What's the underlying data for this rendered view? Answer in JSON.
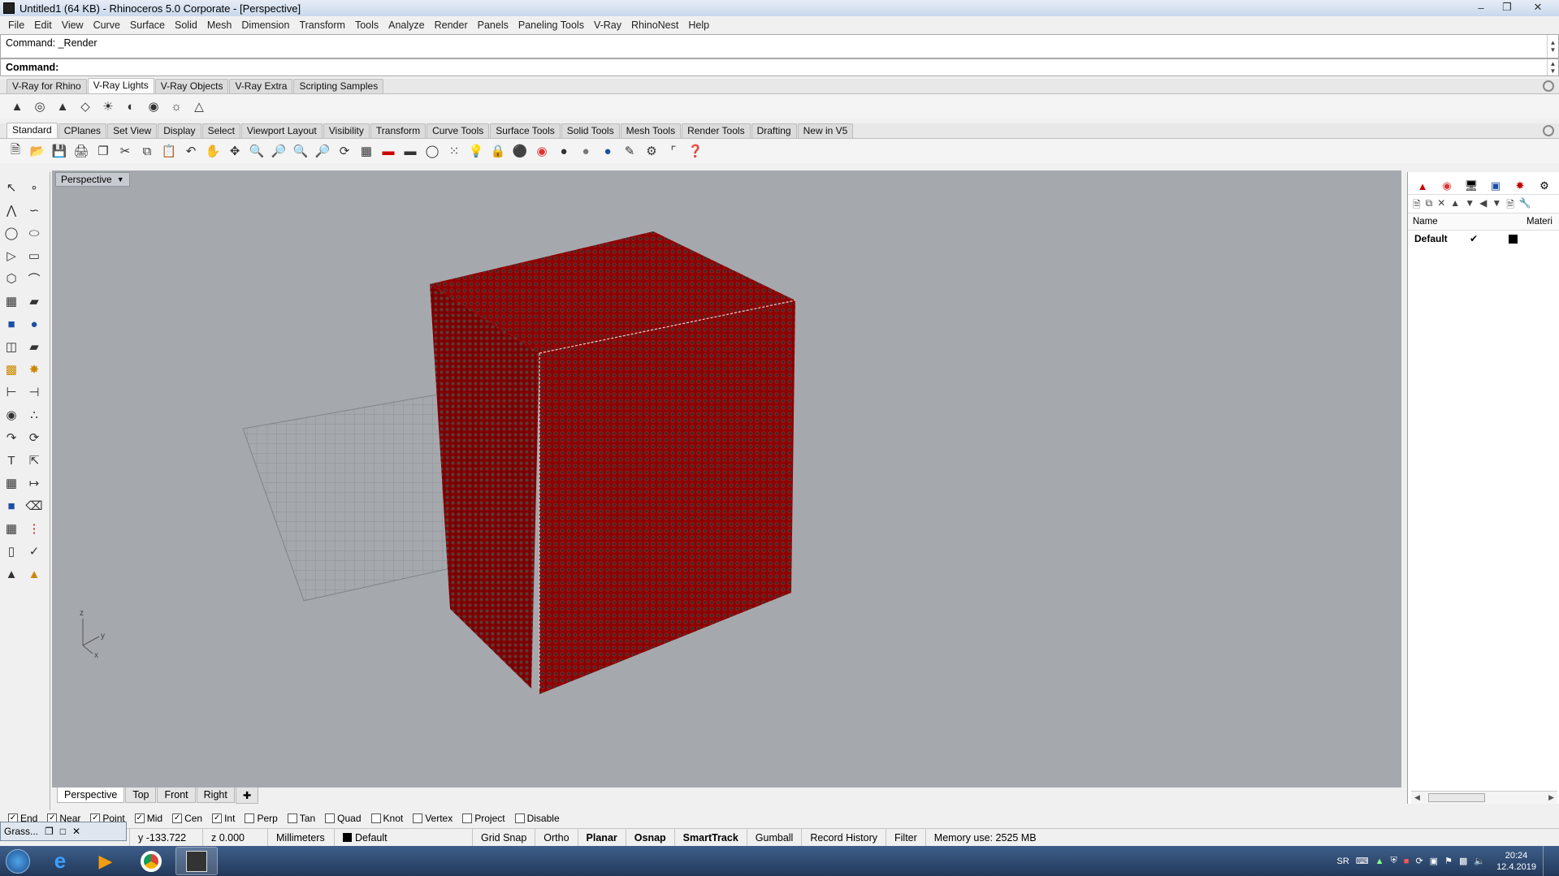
{
  "window": {
    "title": "Untitled1 (64 KB) - Rhinoceros  5.0 Corporate - [Perspective]"
  },
  "menu": [
    "File",
    "Edit",
    "View",
    "Curve",
    "Surface",
    "Solid",
    "Mesh",
    "Dimension",
    "Transform",
    "Tools",
    "Analyze",
    "Render",
    "Panels",
    "Paneling Tools",
    "V-Ray",
    "RhinoNest",
    "Help"
  ],
  "command": {
    "history": "Command: _Render",
    "prompt": "Command:"
  },
  "toolbar_tabs_1": [
    "V-Ray for Rhino",
    "V-Ray Lights",
    "V-Ray Objects",
    "V-Ray Extra",
    "Scripting Samples"
  ],
  "toolbar_tabs_2": [
    "Standard",
    "CPlanes",
    "Set View",
    "Display",
    "Select",
    "Viewport Layout",
    "Visibility",
    "Transform",
    "Curve Tools",
    "Surface Tools",
    "Solid Tools",
    "Mesh Tools",
    "Render Tools",
    "Drafting",
    "New in V5"
  ],
  "viewport": {
    "title": "Perspective",
    "axis_z": "z",
    "axis_y": "y",
    "axis_x": "x"
  },
  "viewport_tabs": [
    "Perspective",
    "Top",
    "Front",
    "Right"
  ],
  "layers": {
    "col_name": "Name",
    "col_material": "Materi",
    "row_name": "Default",
    "row_check": "✔"
  },
  "osnaps": [
    {
      "label": "End",
      "checked": true
    },
    {
      "label": "Near",
      "checked": true
    },
    {
      "label": "Point",
      "checked": true
    },
    {
      "label": "Mid",
      "checked": true
    },
    {
      "label": "Cen",
      "checked": true
    },
    {
      "label": "Int",
      "checked": true
    },
    {
      "label": "Perp",
      "checked": false
    },
    {
      "label": "Tan",
      "checked": false
    },
    {
      "label": "Quad",
      "checked": false
    },
    {
      "label": "Knot",
      "checked": false
    },
    {
      "label": "Vertex",
      "checked": false
    },
    {
      "label": "Project",
      "checked": false
    },
    {
      "label": "Disable",
      "checked": false
    }
  ],
  "status": {
    "y": "y -133.722",
    "z": "z 0.000",
    "units": "Millimeters",
    "layer": "Default",
    "grid_snap": "Grid Snap",
    "ortho": "Ortho",
    "planar": "Planar",
    "osnap": "Osnap",
    "smarttrack": "SmartTrack",
    "gumball": "Gumball",
    "record_history": "Record History",
    "filter": "Filter",
    "memory": "Memory use: 2525 MB"
  },
  "grasshopper_popup": {
    "label": "Grass..."
  },
  "taskbar": {
    "lang": "SR",
    "time": "20:24",
    "date": "12.4.2019"
  },
  "colors": {
    "mesh_red": "#8b0000",
    "viewport_bg": "#a5a9ae"
  }
}
